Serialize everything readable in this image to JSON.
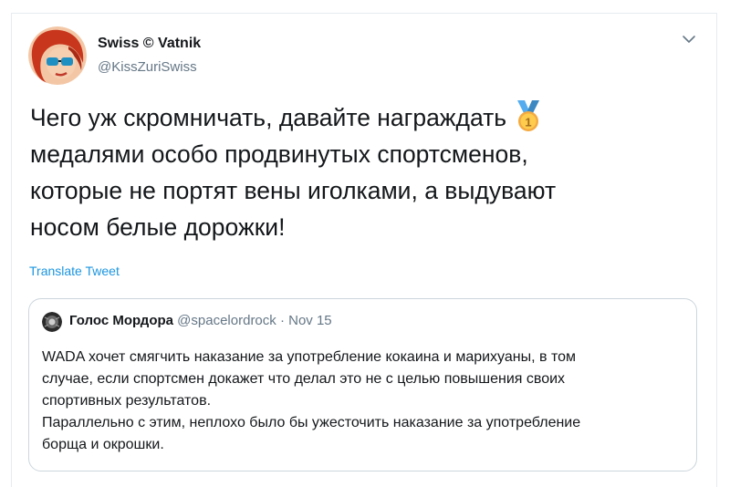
{
  "author": {
    "name": "Swiss © Vatnik",
    "handle": "@KissZuriSwiss"
  },
  "tweet": {
    "line1": "Чего уж скромничать, давайте награждать",
    "line2": " медалями особо продвинутых спортсменов,",
    "line3": "которые не портят вены иголками, а выдувают",
    "line4": "носом белые дорожки!",
    "emoji": "medal-icon",
    "medal_number": "1"
  },
  "translate_label": "Translate Tweet",
  "quote": {
    "name": "Голос Мордора",
    "handle": "@spacelordrock",
    "separator": "·",
    "date": "Nov 15",
    "line1": "WADA хочет смягчить наказание за употребление кокаина и марихуаны, в том",
    "line2": "случае, если спортсмен докажет что делал это не с целью повышения своих",
    "line3": "спортивных результатов.",
    "line4": "Параллельно с этим, неплохо было бы ужесточить наказание за употребление",
    "line5": "борща и окрошки."
  },
  "colors": {
    "link": "#1b95e0",
    "secondary_text": "#657786",
    "border": "#ccd6dd"
  }
}
